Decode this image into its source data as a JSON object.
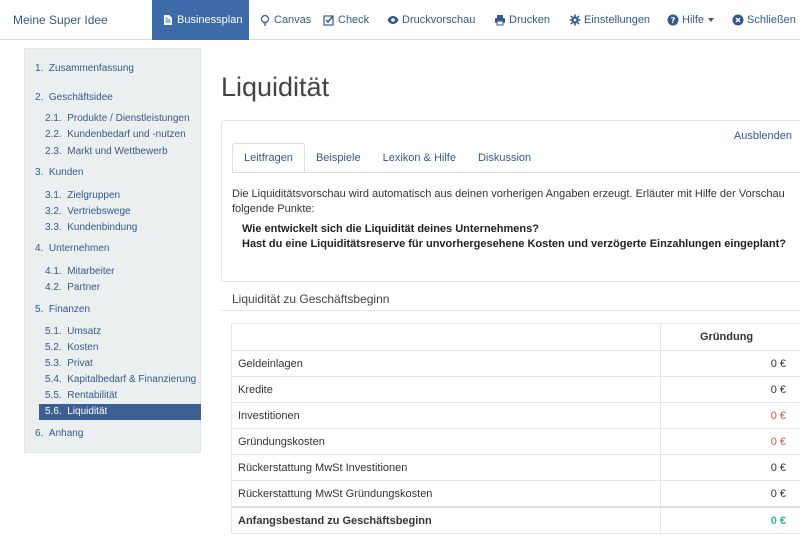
{
  "nav": {
    "brand": "Meine Super Idee",
    "items": [
      {
        "label": "Businessplan",
        "icon": "document-icon"
      },
      {
        "label": "Canvas",
        "icon": "lightbulb-icon"
      },
      {
        "label": "Check",
        "icon": "checkbox-icon"
      },
      {
        "label": "Druckvorschau",
        "icon": "eye-icon"
      },
      {
        "label": "Drucken",
        "icon": "printer-icon"
      },
      {
        "label": "Einstellungen",
        "icon": "gear-icon"
      },
      {
        "label": "Hilfe",
        "icon": "question-icon"
      },
      {
        "label": "Schließen",
        "icon": "close-circle-icon"
      }
    ]
  },
  "sidebar": {
    "items": [
      {
        "num": "1.",
        "label": "Zusammenfassung"
      },
      {
        "num": "2.",
        "label": "Geschäftsidee"
      },
      {
        "num": "2.1.",
        "label": "Produkte / Dienstleistungen"
      },
      {
        "num": "2.2.",
        "label": "Kundenbedarf und -nutzen"
      },
      {
        "num": "2.3.",
        "label": "Markt und Wettbewerb"
      },
      {
        "num": "3.",
        "label": "Kunden"
      },
      {
        "num": "3.1.",
        "label": "Zielgruppen"
      },
      {
        "num": "3.2.",
        "label": "Vertriebswege"
      },
      {
        "num": "3.3.",
        "label": "Kundenbindung"
      },
      {
        "num": "4.",
        "label": "Unternehmen"
      },
      {
        "num": "4.1.",
        "label": "Mitarbeiter"
      },
      {
        "num": "4.2.",
        "label": "Partner"
      },
      {
        "num": "5.",
        "label": "Finanzen"
      },
      {
        "num": "5.1.",
        "label": "Umsatz"
      },
      {
        "num": "5.2.",
        "label": "Kosten"
      },
      {
        "num": "5.3.",
        "label": "Privat"
      },
      {
        "num": "5.4.",
        "label": "Kapitalbedarf & Finanzierung"
      },
      {
        "num": "5.5.",
        "label": "Rentabilität"
      },
      {
        "num": "5.6.",
        "label": "Liquidität"
      },
      {
        "num": "6.",
        "label": "Anhang"
      }
    ]
  },
  "main": {
    "title": "Liquidität",
    "hide_label": "Ausblenden",
    "tabs": [
      "Leitfragen",
      "Beispiele",
      "Lexikon & Hilfe",
      "Diskussion"
    ],
    "intro": "Die Liquiditätsvorschau wird automatisch aus deinen vorherigen Angaben erzeugt. Erläuter mit Hilfe der Vorschau folgende Punkte:",
    "question1": "Wie entwickelt sich die Liquidität deines Unternehmens?",
    "question2": "Hast du eine Liquiditätsreserve für unvorhergesehene Kosten und verzögerte Einzahlungen eingeplant?",
    "section_title": "Liquidität zu Geschäftsbeginn",
    "table": {
      "column": "Gründung",
      "rows": [
        {
          "label": "Geldeinlagen",
          "value": "0 €"
        },
        {
          "label": "Kredite",
          "value": "0 €"
        },
        {
          "label": "Investitionen",
          "value": "0 €"
        },
        {
          "label": "Gründungskosten",
          "value": "0 €"
        },
        {
          "label": "Rückerstattung MwSt Investitionen",
          "value": "0 €"
        },
        {
          "label": "Rückerstattung MwSt Gründungskosten",
          "value": "0 €"
        },
        {
          "label": "Anfangsbestand zu Geschäftsbeginn",
          "value": "0 €"
        }
      ]
    }
  },
  "colors": {
    "accent": "#3d6aa8",
    "link": "#34598f",
    "negative": "#d9534f",
    "positive": "#2fb79a"
  }
}
